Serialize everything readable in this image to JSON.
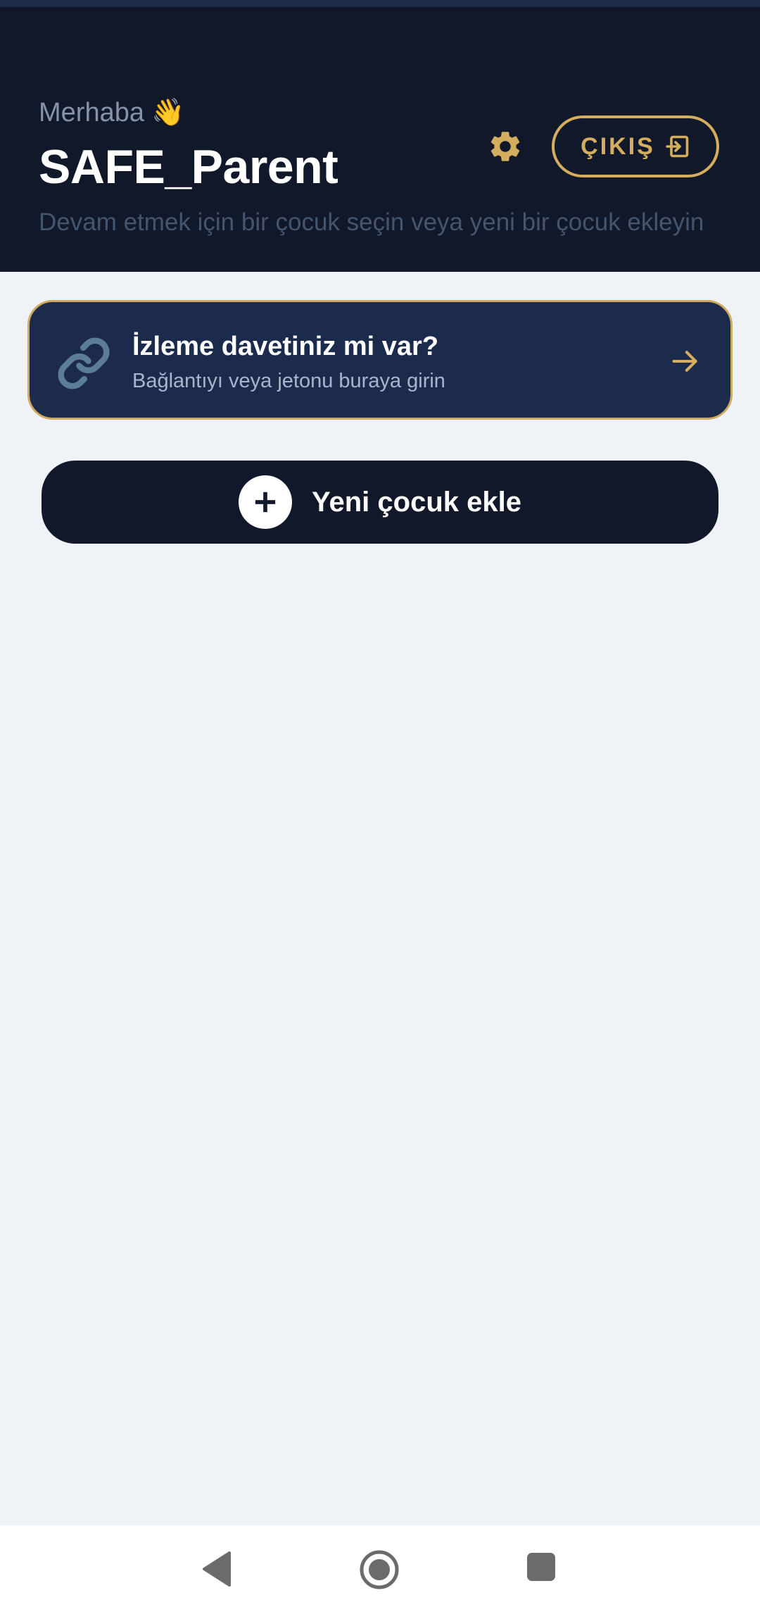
{
  "header": {
    "greeting": "Merhaba",
    "wave_emoji": "👋",
    "username": "SAFE_Parent",
    "subtitle": "Devam etmek için bir çocuk seçin veya yeni bir çocuk ekleyin",
    "settings_icon": "gear-icon",
    "logout_label": "ÇIKIŞ",
    "logout_icon": "sign-out-icon"
  },
  "invite_card": {
    "icon": "link-icon",
    "title": "İzleme davetiniz mi var?",
    "subtitle": "Bağlantıyı veya jetonu buraya girin",
    "arrow_icon": "arrow-right-icon"
  },
  "add_child": {
    "icon": "plus-icon",
    "label": "Yeni çocuk ekle"
  },
  "navbar": {
    "back_icon": "back-triangle-icon",
    "home_icon": "home-circle-icon",
    "recent_icon": "recent-square-icon"
  },
  "colors": {
    "header_bg": "#10182A",
    "page_bg": "#EFF3F8",
    "accent_gold": "#D4AE5E",
    "card_bg": "#1C2B4C",
    "link_icon": "#5C7D9A"
  }
}
